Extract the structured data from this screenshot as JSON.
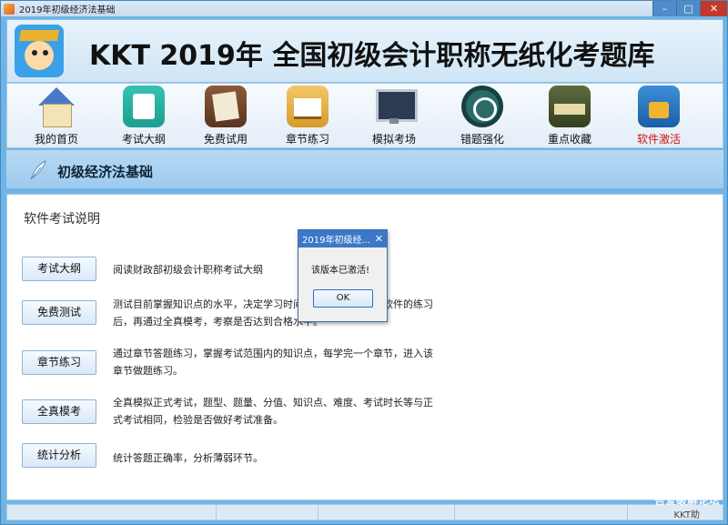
{
  "window": {
    "title": "2019年初级经济法基础",
    "minimize": "–",
    "maximize": "□",
    "close": "✕"
  },
  "banner": {
    "title": "KKT 2019年 全国初级会计职称无纸化考题库"
  },
  "toolbar": {
    "items": [
      {
        "label": "我的首页",
        "icon": "house-icon"
      },
      {
        "label": "考试大纲",
        "icon": "outline-book-icon"
      },
      {
        "label": "免费试用",
        "icon": "pencil-paper-icon"
      },
      {
        "label": "章节练习",
        "icon": "open-book-icon"
      },
      {
        "label": "模拟考场",
        "icon": "monitor-icon"
      },
      {
        "label": "错题强化",
        "icon": "clock-arrow-icon"
      },
      {
        "label": "重点收藏",
        "icon": "favorites-icon"
      },
      {
        "label": "软件激活",
        "icon": "lock-envelope-icon",
        "active": true
      }
    ],
    "active_color": "#d01414"
  },
  "section": {
    "title": "初级经济法基础"
  },
  "content": {
    "title": "软件考试说明",
    "rows": [
      {
        "button": "考试大纲",
        "desc": "阅读财政部初级会计职称考试大纲"
      },
      {
        "button": "免费测试",
        "desc": "测试目前掌握知识点的水平，决定学习时间，判断是否需要本软件的练习后，再通过全真模考，考察是否达到合格水平。"
      },
      {
        "button": "章节练习",
        "desc": "通过章节答题练习，掌握考试范围内的知识点，每学完一个章节，进入该章节做题练习。"
      },
      {
        "button": "全真模考",
        "desc": "全真模拟正式考试，题型、题量、分值、知识点、难度、考试时长等与正式考试相同，检验是否做好考试准备。"
      },
      {
        "button": "统计分析",
        "desc": "统计答题正确率，分析薄弱环节。"
      }
    ]
  },
  "dialog": {
    "title": "2019年初级经...",
    "close": "✕",
    "message": "该版本已激活!",
    "ok": "OK"
  },
  "watermark": {
    "site": "吾爱破解论坛",
    "tag": "KKT助"
  }
}
